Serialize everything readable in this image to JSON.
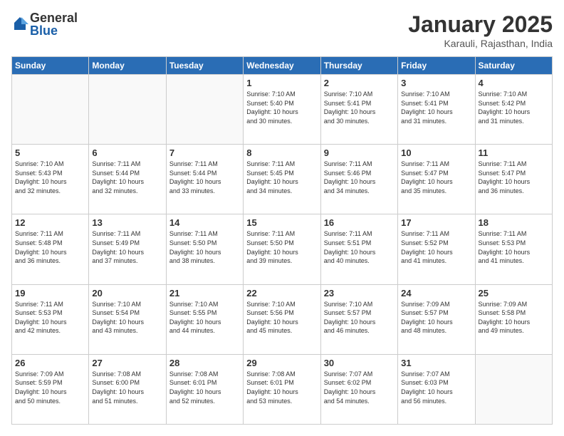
{
  "logo": {
    "general": "General",
    "blue": "Blue"
  },
  "header": {
    "month": "January 2025",
    "location": "Karauli, Rajasthan, India"
  },
  "days_of_week": [
    "Sunday",
    "Monday",
    "Tuesday",
    "Wednesday",
    "Thursday",
    "Friday",
    "Saturday"
  ],
  "weeks": [
    [
      {
        "day": "",
        "info": ""
      },
      {
        "day": "",
        "info": ""
      },
      {
        "day": "",
        "info": ""
      },
      {
        "day": "1",
        "info": "Sunrise: 7:10 AM\nSunset: 5:40 PM\nDaylight: 10 hours\nand 30 minutes."
      },
      {
        "day": "2",
        "info": "Sunrise: 7:10 AM\nSunset: 5:41 PM\nDaylight: 10 hours\nand 30 minutes."
      },
      {
        "day": "3",
        "info": "Sunrise: 7:10 AM\nSunset: 5:41 PM\nDaylight: 10 hours\nand 31 minutes."
      },
      {
        "day": "4",
        "info": "Sunrise: 7:10 AM\nSunset: 5:42 PM\nDaylight: 10 hours\nand 31 minutes."
      }
    ],
    [
      {
        "day": "5",
        "info": "Sunrise: 7:10 AM\nSunset: 5:43 PM\nDaylight: 10 hours\nand 32 minutes."
      },
      {
        "day": "6",
        "info": "Sunrise: 7:11 AM\nSunset: 5:44 PM\nDaylight: 10 hours\nand 32 minutes."
      },
      {
        "day": "7",
        "info": "Sunrise: 7:11 AM\nSunset: 5:44 PM\nDaylight: 10 hours\nand 33 minutes."
      },
      {
        "day": "8",
        "info": "Sunrise: 7:11 AM\nSunset: 5:45 PM\nDaylight: 10 hours\nand 34 minutes."
      },
      {
        "day": "9",
        "info": "Sunrise: 7:11 AM\nSunset: 5:46 PM\nDaylight: 10 hours\nand 34 minutes."
      },
      {
        "day": "10",
        "info": "Sunrise: 7:11 AM\nSunset: 5:47 PM\nDaylight: 10 hours\nand 35 minutes."
      },
      {
        "day": "11",
        "info": "Sunrise: 7:11 AM\nSunset: 5:47 PM\nDaylight: 10 hours\nand 36 minutes."
      }
    ],
    [
      {
        "day": "12",
        "info": "Sunrise: 7:11 AM\nSunset: 5:48 PM\nDaylight: 10 hours\nand 36 minutes."
      },
      {
        "day": "13",
        "info": "Sunrise: 7:11 AM\nSunset: 5:49 PM\nDaylight: 10 hours\nand 37 minutes."
      },
      {
        "day": "14",
        "info": "Sunrise: 7:11 AM\nSunset: 5:50 PM\nDaylight: 10 hours\nand 38 minutes."
      },
      {
        "day": "15",
        "info": "Sunrise: 7:11 AM\nSunset: 5:50 PM\nDaylight: 10 hours\nand 39 minutes."
      },
      {
        "day": "16",
        "info": "Sunrise: 7:11 AM\nSunset: 5:51 PM\nDaylight: 10 hours\nand 40 minutes."
      },
      {
        "day": "17",
        "info": "Sunrise: 7:11 AM\nSunset: 5:52 PM\nDaylight: 10 hours\nand 41 minutes."
      },
      {
        "day": "18",
        "info": "Sunrise: 7:11 AM\nSunset: 5:53 PM\nDaylight: 10 hours\nand 41 minutes."
      }
    ],
    [
      {
        "day": "19",
        "info": "Sunrise: 7:11 AM\nSunset: 5:53 PM\nDaylight: 10 hours\nand 42 minutes."
      },
      {
        "day": "20",
        "info": "Sunrise: 7:10 AM\nSunset: 5:54 PM\nDaylight: 10 hours\nand 43 minutes."
      },
      {
        "day": "21",
        "info": "Sunrise: 7:10 AM\nSunset: 5:55 PM\nDaylight: 10 hours\nand 44 minutes."
      },
      {
        "day": "22",
        "info": "Sunrise: 7:10 AM\nSunset: 5:56 PM\nDaylight: 10 hours\nand 45 minutes."
      },
      {
        "day": "23",
        "info": "Sunrise: 7:10 AM\nSunset: 5:57 PM\nDaylight: 10 hours\nand 46 minutes."
      },
      {
        "day": "24",
        "info": "Sunrise: 7:09 AM\nSunset: 5:57 PM\nDaylight: 10 hours\nand 48 minutes."
      },
      {
        "day": "25",
        "info": "Sunrise: 7:09 AM\nSunset: 5:58 PM\nDaylight: 10 hours\nand 49 minutes."
      }
    ],
    [
      {
        "day": "26",
        "info": "Sunrise: 7:09 AM\nSunset: 5:59 PM\nDaylight: 10 hours\nand 50 minutes."
      },
      {
        "day": "27",
        "info": "Sunrise: 7:08 AM\nSunset: 6:00 PM\nDaylight: 10 hours\nand 51 minutes."
      },
      {
        "day": "28",
        "info": "Sunrise: 7:08 AM\nSunset: 6:01 PM\nDaylight: 10 hours\nand 52 minutes."
      },
      {
        "day": "29",
        "info": "Sunrise: 7:08 AM\nSunset: 6:01 PM\nDaylight: 10 hours\nand 53 minutes."
      },
      {
        "day": "30",
        "info": "Sunrise: 7:07 AM\nSunset: 6:02 PM\nDaylight: 10 hours\nand 54 minutes."
      },
      {
        "day": "31",
        "info": "Sunrise: 7:07 AM\nSunset: 6:03 PM\nDaylight: 10 hours\nand 56 minutes."
      },
      {
        "day": "",
        "info": ""
      }
    ]
  ]
}
